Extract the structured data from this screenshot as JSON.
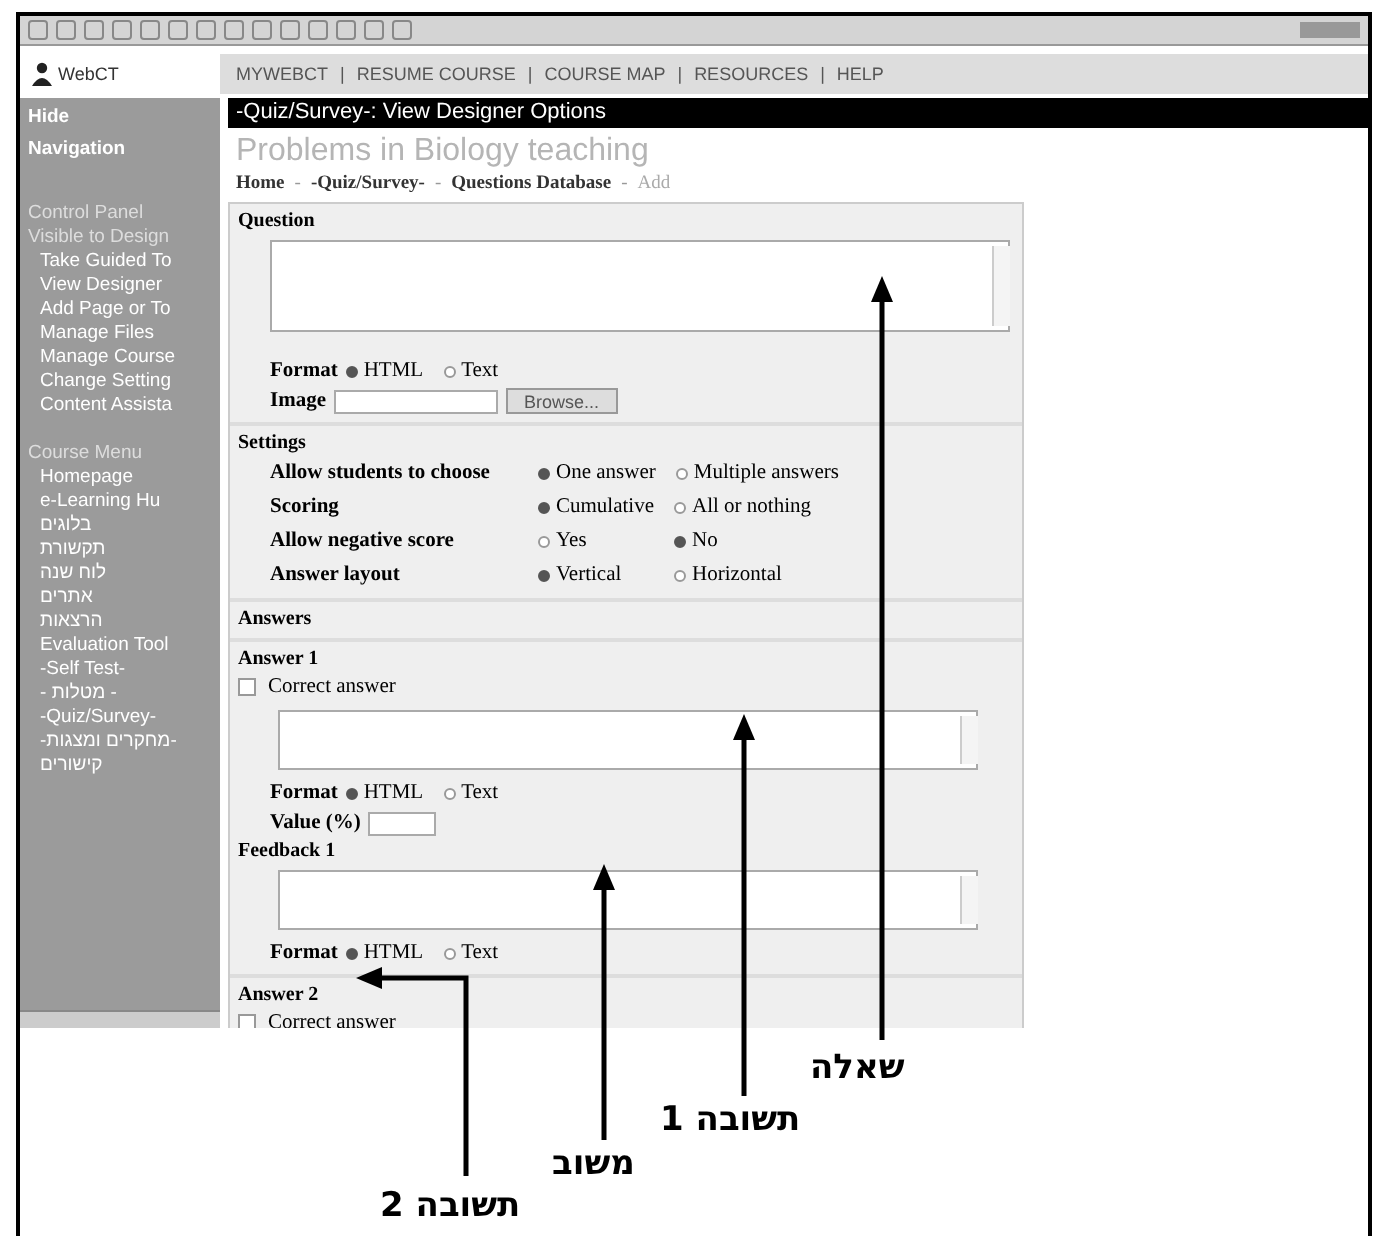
{
  "nav": {
    "logo": "WebCT",
    "links": [
      "MYWEBCT",
      "RESUME COURSE",
      "COURSE MAP",
      "RESOURCES",
      "HELP"
    ],
    "separator": "|"
  },
  "sidebar": {
    "hide": "Hide Navigation",
    "sections": [
      {
        "title": "Control Panel",
        "subtitle": "Visible to Design",
        "items": [
          "Take Guided To",
          "View Designer",
          "Add Page or To",
          "Manage Files",
          "Manage Course",
          "Change Setting",
          "Content Assista"
        ]
      },
      {
        "title": "Course Menu",
        "items": [
          "Homepage",
          "e-Learning Hu",
          "בלוגים",
          "תקשורת",
          "לוח שנה",
          "אתרים",
          "הרצאות",
          "Evaluation Tool",
          "-Self Test-",
          "- מטלות -",
          "-Quiz/Survey-",
          "-מחקרים ומצגות-",
          "קישורים"
        ]
      }
    ]
  },
  "band": "-Quiz/Survey-:  View  Designer Options",
  "title": "Problems in Biology teaching",
  "breadcrumb_separators": [
    "-",
    "-",
    "-"
  ],
  "breadcrumb": [
    {
      "label": "Home",
      "current": false
    },
    {
      "label": "-Quiz/Survey-",
      "current": false
    },
    {
      "label": "Questions Database",
      "current": false
    },
    {
      "label": "Add",
      "current": true
    }
  ],
  "question": {
    "title": "Question",
    "format_label": "Format",
    "formats": [
      {
        "label": "HTML",
        "selected": true
      },
      {
        "label": "Text",
        "selected": false
      }
    ],
    "image_label": "Image",
    "browse": "Browse..."
  },
  "settings": {
    "title": "Settings",
    "rows": [
      {
        "label": "Allow students to choose",
        "options": [
          {
            "label": "One answer",
            "selected": true
          },
          {
            "label": "Multiple answers",
            "selected": false
          }
        ]
      },
      {
        "label": "Scoring",
        "options": [
          {
            "label": "Cumulative",
            "selected": true
          },
          {
            "label": "All or nothing",
            "selected": false
          }
        ]
      },
      {
        "label": "Allow negative score",
        "options": [
          {
            "label": "Yes",
            "selected": false
          },
          {
            "label": "No",
            "selected": true
          }
        ]
      },
      {
        "label": "Answer layout",
        "options": [
          {
            "label": "Vertical",
            "selected": true
          },
          {
            "label": "Horizontal",
            "selected": false
          }
        ]
      }
    ]
  },
  "answers": {
    "title": "Answers",
    "items": [
      {
        "title": "Answer 1",
        "correct_label": "Correct answer",
        "correct": false,
        "format_label": "Format",
        "formats": [
          {
            "label": "HTML",
            "selected": true
          },
          {
            "label": "Text",
            "selected": false
          }
        ],
        "value_label": "Value (%)",
        "feedback_title": "Feedback 1",
        "feedback_format_label": "Format",
        "feedback_formats": [
          {
            "label": "HTML",
            "selected": true
          },
          {
            "label": "Text",
            "selected": false
          }
        ]
      },
      {
        "title": "Answer 2",
        "correct_label": "Correct answer",
        "correct": false
      }
    ]
  },
  "annotations": [
    {
      "label": "שאלה"
    },
    {
      "label": "תשובה 1"
    },
    {
      "label": "משוב"
    },
    {
      "label": "תשובה 2"
    }
  ]
}
